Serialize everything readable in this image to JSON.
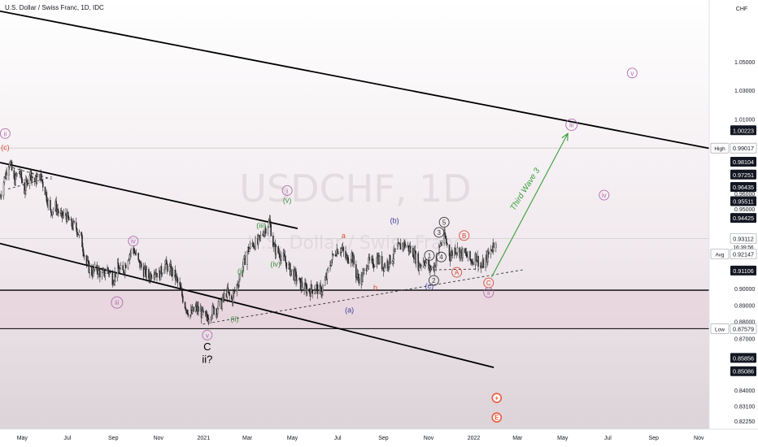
{
  "header": {
    "title": "U.S. Dollar / Swiss Franc, 1D, IDC"
  },
  "watermark": {
    "symbol": "USDCHF, 1D",
    "subtitle": "U.S. Dollar / Swiss Franc"
  },
  "chart_data": {
    "type": "candlestick",
    "currency": "CHF",
    "ylim": [
      0.818,
      1.095
    ],
    "y_scale": "log",
    "x_range": [
      "2020-04-01",
      "2022-11-15"
    ],
    "x_ticks": [
      {
        "date": "2020-05-01",
        "label": "May"
      },
      {
        "date": "2020-07-01",
        "label": "Jul"
      },
      {
        "date": "2020-09-01",
        "label": "Sep"
      },
      {
        "date": "2020-11-01",
        "label": "Nov"
      },
      {
        "date": "2021-01-01",
        "label": "2021"
      },
      {
        "date": "2021-03-01",
        "label": "Mar"
      },
      {
        "date": "2021-05-01",
        "label": "May"
      },
      {
        "date": "2021-07-01",
        "label": "Jul"
      },
      {
        "date": "2021-09-01",
        "label": "Sep"
      },
      {
        "date": "2021-11-01",
        "label": "Nov"
      },
      {
        "date": "2022-01-01",
        "label": "2022"
      },
      {
        "date": "2022-03-01",
        "label": "Mar"
      },
      {
        "date": "2022-05-01",
        "label": "May"
      },
      {
        "date": "2022-07-01",
        "label": "Jul"
      },
      {
        "date": "2022-09-01",
        "label": "Sep"
      },
      {
        "date": "2022-11-01",
        "label": "Nov"
      }
    ],
    "y_ticks": [
      "1.05000",
      "1.03000",
      "1.01000",
      "0.96000",
      "0.95000",
      "0.90000",
      "0.89000",
      "0.88000",
      "0.87000",
      "0.84000",
      "0.83100",
      "0.82250"
    ],
    "price_labels": [
      {
        "text": "1.00223",
        "y": 1.00223,
        "style": "dark"
      },
      {
        "text": "0.99017",
        "y": 0.99017,
        "style": "light",
        "tag": "High"
      },
      {
        "text": "0.98104",
        "y": 0.98104,
        "style": "dark"
      },
      {
        "text": "0.97251",
        "y": 0.97251,
        "style": "dark"
      },
      {
        "text": "0.96435",
        "y": 0.96435,
        "style": "dark"
      },
      {
        "text": "0.95511",
        "y": 0.95511,
        "style": "dark"
      },
      {
        "text": "0.94425",
        "y": 0.94425,
        "style": "dark"
      },
      {
        "text": "0.93112",
        "y": 0.93112,
        "style": "light",
        "sub": "16:39:56"
      },
      {
        "text": "0.92147",
        "y": 0.92147,
        "style": "light",
        "tag": "Avg"
      },
      {
        "text": "0.91106",
        "y": 0.91106,
        "style": "dark"
      },
      {
        "text": "0.87579",
        "y": 0.87579,
        "style": "light",
        "tag": "Low"
      },
      {
        "text": "0.85856",
        "y": 0.85856,
        "style": "dark"
      },
      {
        "text": "0.85086",
        "y": 0.85086,
        "style": "dark"
      }
    ],
    "price_path": [
      [
        "2020-04-01",
        0.958
      ],
      [
        "2020-04-08",
        0.972
      ],
      [
        "2020-04-14",
        0.982
      ],
      [
        "2020-04-20",
        0.968
      ],
      [
        "2020-04-27",
        0.975
      ],
      [
        "2020-05-04",
        0.962
      ],
      [
        "2020-05-11",
        0.974
      ],
      [
        "2020-05-18",
        0.968
      ],
      [
        "2020-05-25",
        0.972
      ],
      [
        "2020-06-01",
        0.962
      ],
      [
        "2020-06-08",
        0.948
      ],
      [
        "2020-06-15",
        0.952
      ],
      [
        "2020-06-22",
        0.945
      ],
      [
        "2020-06-29",
        0.946
      ],
      [
        "2020-07-06",
        0.94
      ],
      [
        "2020-07-13",
        0.938
      ],
      [
        "2020-07-20",
        0.93
      ],
      [
        "2020-07-27",
        0.915
      ],
      [
        "2020-08-03",
        0.91
      ],
      [
        "2020-08-10",
        0.912
      ],
      [
        "2020-08-17",
        0.908
      ],
      [
        "2020-08-24",
        0.912
      ],
      [
        "2020-08-31",
        0.906
      ],
      [
        "2020-09-07",
        0.912
      ],
      [
        "2020-09-14",
        0.91
      ],
      [
        "2020-09-21",
        0.92
      ],
      [
        "2020-09-28",
        0.925
      ],
      [
        "2020-10-05",
        0.916
      ],
      [
        "2020-10-12",
        0.911
      ],
      [
        "2020-10-19",
        0.907
      ],
      [
        "2020-10-26",
        0.912
      ],
      [
        "2020-11-02",
        0.908
      ],
      [
        "2020-11-09",
        0.915
      ],
      [
        "2020-11-16",
        0.912
      ],
      [
        "2020-11-23",
        0.908
      ],
      [
        "2020-11-30",
        0.9
      ],
      [
        "2020-12-07",
        0.89
      ],
      [
        "2020-12-14",
        0.884
      ],
      [
        "2020-12-21",
        0.888
      ],
      [
        "2020-12-28",
        0.886
      ],
      [
        "2021-01-04",
        0.881
      ],
      [
        "2021-01-11",
        0.886
      ],
      [
        "2021-01-18",
        0.888
      ],
      [
        "2021-01-25",
        0.891
      ],
      [
        "2021-02-01",
        0.898
      ],
      [
        "2021-02-08",
        0.893
      ],
      [
        "2021-02-15",
        0.902
      ],
      [
        "2021-02-22",
        0.912
      ],
      [
        "2021-03-01",
        0.923
      ],
      [
        "2021-03-08",
        0.928
      ],
      [
        "2021-03-15",
        0.928
      ],
      [
        "2021-03-22",
        0.935
      ],
      [
        "2021-03-31",
        0.942
      ],
      [
        "2021-04-06",
        0.925
      ],
      [
        "2021-04-13",
        0.922
      ],
      [
        "2021-04-20",
        0.918
      ],
      [
        "2021-04-27",
        0.912
      ],
      [
        "2021-05-04",
        0.908
      ],
      [
        "2021-05-11",
        0.903
      ],
      [
        "2021-05-18",
        0.9
      ],
      [
        "2021-05-25",
        0.899
      ],
      [
        "2021-06-01",
        0.901
      ],
      [
        "2021-06-08",
        0.898
      ],
      [
        "2021-06-15",
        0.905
      ],
      [
        "2021-06-22",
        0.917
      ],
      [
        "2021-06-29",
        0.924
      ],
      [
        "2021-07-06",
        0.925
      ],
      [
        "2021-07-13",
        0.918
      ],
      [
        "2021-07-20",
        0.921
      ],
      [
        "2021-07-27",
        0.907
      ],
      [
        "2021-08-03",
        0.906
      ],
      [
        "2021-08-10",
        0.916
      ],
      [
        "2021-08-17",
        0.915
      ],
      [
        "2021-08-24",
        0.919
      ],
      [
        "2021-08-31",
        0.914
      ],
      [
        "2021-09-07",
        0.916
      ],
      [
        "2021-09-14",
        0.92
      ],
      [
        "2021-09-21",
        0.925
      ],
      [
        "2021-09-28",
        0.928
      ],
      [
        "2021-10-05",
        0.925
      ],
      [
        "2021-10-12",
        0.922
      ],
      [
        "2021-10-19",
        0.914
      ],
      [
        "2021-10-26",
        0.918
      ],
      [
        "2021-11-02",
        0.912
      ],
      [
        "2021-11-09",
        0.914
      ],
      [
        "2021-11-16",
        0.927
      ],
      [
        "2021-11-23",
        0.932
      ],
      [
        "2021-11-30",
        0.92
      ],
      [
        "2021-12-07",
        0.925
      ],
      [
        "2021-12-14",
        0.922
      ],
      [
        "2021-12-21",
        0.921
      ],
      [
        "2021-12-28",
        0.917
      ],
      [
        "2022-01-04",
        0.92
      ],
      [
        "2022-01-11",
        0.913
      ],
      [
        "2022-01-18",
        0.918
      ],
      [
        "2022-01-25",
        0.925
      ],
      [
        "2022-01-31",
        0.931
      ]
    ],
    "trendlines": [
      {
        "name": "upper-channel-line",
        "style": "solid",
        "color": "#000000",
        "from": [
          "2020-03-01",
          1.09
        ],
        "to": [
          "2022-11-20",
          0.9895
        ]
      },
      {
        "name": "wave-channel-top",
        "style": "solid",
        "color": "#000000",
        "from": [
          "2020-04-01",
          0.9805
        ],
        "to": [
          "2021-05-08",
          0.9375
        ]
      },
      {
        "name": "wave-channel-bottom",
        "style": "solid",
        "color": "#000000",
        "from": [
          "2020-04-01",
          0.928
        ],
        "to": [
          "2022-01-28",
          0.853
        ]
      },
      {
        "name": "support-dashed-line",
        "style": "dashed",
        "color": "#444444",
        "from": [
          "2020-12-31",
          0.8785
        ],
        "to": [
          "2022-03-08",
          0.9115
        ]
      },
      {
        "name": "triangle-upper",
        "style": "dashed",
        "color": "#444444",
        "from": [
          "2020-04-12",
          0.978
        ],
        "to": [
          "2020-06-10",
          0.9695
        ]
      },
      {
        "name": "triangle-lower",
        "style": "dashed",
        "color": "#444444",
        "from": [
          "2020-04-12",
          0.963
        ],
        "to": [
          "2020-06-10",
          0.971
        ]
      },
      {
        "name": "pattern-neckline",
        "style": "dashed",
        "color": "#444444",
        "from": [
          "2021-11-02",
          0.9115
        ],
        "to": [
          "2022-01-08",
          0.912
        ]
      }
    ],
    "levels": [
      {
        "name": "high-level-line",
        "y": 0.99017,
        "color": "#cccccc",
        "width": 0.8
      },
      {
        "name": "last-price-line",
        "y": 0.93112,
        "color": "#cccccc",
        "width": 0.8
      },
      {
        "name": "support-level-line",
        "y": 0.899,
        "color": "#000000",
        "width": 1.4
      },
      {
        "name": "low-level-line",
        "y": 0.87579,
        "color": "#000000",
        "width": 1.0
      }
    ],
    "shaded_band": {
      "from": 0.8755,
      "to": 0.899,
      "color": "#e7d3db"
    },
    "projection_arrow": {
      "from": [
        "2022-01-25",
        0.907
      ],
      "to": [
        "2022-05-08",
        1.0
      ],
      "color": "#3a9e3a"
    },
    "annotations": [
      {
        "text": "ii",
        "date": "2020-04-08",
        "price": 1.0,
        "color": "#b36ab0",
        "shape": "circle"
      },
      {
        "text": "(c)",
        "date": "2020-04-08",
        "price": 0.9905,
        "color": "#d84a38",
        "shape": "none"
      },
      {
        "text": "iv",
        "date": "2020-09-28",
        "price": 0.9295,
        "color": "#b36ab0",
        "shape": "circle"
      },
      {
        "text": "iii",
        "date": "2020-09-06",
        "price": 0.8915,
        "color": "#b36ab0",
        "shape": "circle"
      },
      {
        "text": "v",
        "date": "2021-01-06",
        "price": 0.872,
        "color": "#b36ab0",
        "shape": "circle"
      },
      {
        "text": "C",
        "date": "2021-01-06",
        "price": 0.8645,
        "color": "#000000",
        "shape": "none"
      },
      {
        "text": "ii?",
        "date": "2021-01-06",
        "price": 0.857,
        "color": "#000000",
        "shape": "none"
      },
      {
        "text": "(i)",
        "date": "2021-02-20",
        "price": 0.9105,
        "color": "#3c8a3c",
        "shape": "none"
      },
      {
        "text": "(ii)",
        "date": "2021-02-12",
        "price": 0.8815,
        "color": "#3c8a3c",
        "shape": "none"
      },
      {
        "text": "(iii)",
        "date": "2021-03-20",
        "price": 0.9395,
        "color": "#3c8a3c",
        "shape": "none"
      },
      {
        "text": "(iv)",
        "date": "2021-04-08",
        "price": 0.915,
        "color": "#3c8a3c",
        "shape": "none"
      },
      {
        "text": "(v)",
        "date": "2021-04-24",
        "price": 0.9555,
        "color": "#3c8a3c",
        "shape": "none"
      },
      {
        "text": "i",
        "date": "2021-04-24",
        "price": 0.962,
        "color": "#b36ab0",
        "shape": "circle"
      },
      {
        "text": "a",
        "date": "2021-07-09",
        "price": 0.933,
        "color": "#d84a38",
        "shape": "none"
      },
      {
        "text": "b",
        "date": "2021-08-21",
        "price": 0.9005,
        "color": "#d84a38",
        "shape": "none"
      },
      {
        "text": "(a)",
        "date": "2021-07-17",
        "price": 0.887,
        "color": "#3a3a9e",
        "shape": "none"
      },
      {
        "text": "(b)",
        "date": "2021-09-16",
        "price": 0.9425,
        "color": "#3a3a9e",
        "shape": "none"
      },
      {
        "text": "(c)",
        "date": "2021-11-02",
        "price": 0.9015,
        "color": "#3a3a9e",
        "shape": "none"
      },
      {
        "text": "1",
        "date": "2021-11-02",
        "price": 0.9205,
        "color": "#333333",
        "shape": "circle"
      },
      {
        "text": "2",
        "date": "2021-11-08",
        "price": 0.905,
        "color": "#333333",
        "shape": "circle"
      },
      {
        "text": "3",
        "date": "2021-11-15",
        "price": 0.935,
        "color": "#333333",
        "shape": "circle"
      },
      {
        "text": "4",
        "date": "2021-11-18",
        "price": 0.9195,
        "color": "#333333",
        "shape": "circle"
      },
      {
        "text": "5",
        "date": "2021-11-22",
        "price": 0.9415,
        "color": "#333333",
        "shape": "circle"
      },
      {
        "text": "A",
        "date": "2021-12-09",
        "price": 0.91,
        "color": "#d84a38",
        "shape": "circle"
      },
      {
        "text": "B",
        "date": "2021-12-19",
        "price": 0.933,
        "color": "#d84a38",
        "shape": "circle"
      },
      {
        "text": "C",
        "date": "2022-01-21",
        "price": 0.9035,
        "color": "#d84a38",
        "shape": "circle"
      },
      {
        "text": "ii",
        "date": "2022-01-21",
        "price": 0.8975,
        "color": "#b36ab0",
        "shape": "circle"
      },
      {
        "text": "iii",
        "date": "2022-05-13",
        "price": 1.006,
        "color": "#b36ab0",
        "shape": "circle"
      },
      {
        "text": "iv",
        "date": "2022-06-26",
        "price": 0.959,
        "color": "#b36ab0",
        "shape": "circle"
      },
      {
        "text": "v",
        "date": "2022-08-03",
        "price": 1.042,
        "color": "#b36ab0",
        "shape": "circle"
      }
    ],
    "arrow_label": {
      "text": "Third Wave 3",
      "color": "#3a9e3a",
      "date": "2022-03-14",
      "price": 0.962,
      "rotation": -58
    },
    "event_markers": [
      {
        "date": "2022-02-01",
        "price": 0.8355,
        "color": "#e85a3c",
        "symbol": "+"
      },
      {
        "date": "2022-02-01",
        "price": 0.8245,
        "color": "#e85a3c",
        "symbol": "E"
      }
    ]
  }
}
